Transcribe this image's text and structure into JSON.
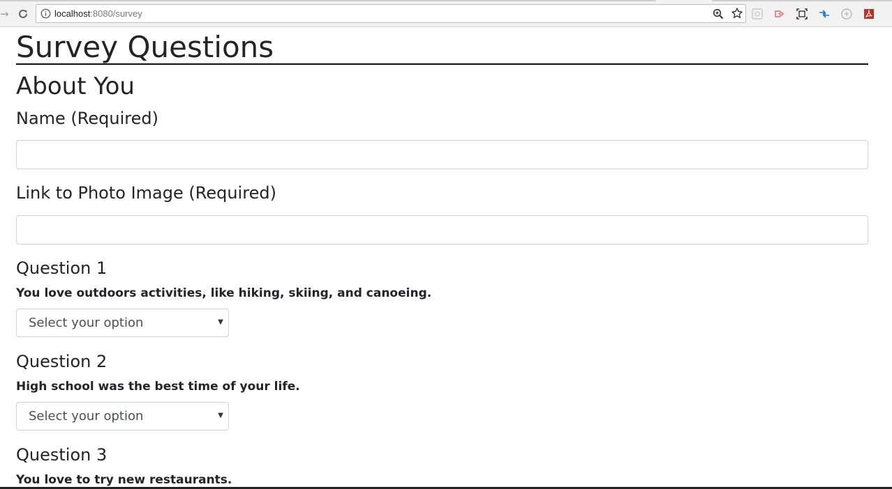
{
  "browser": {
    "url_host": "localhost",
    "url_rest": ":8080/survey"
  },
  "page": {
    "title": "Survey Questions",
    "section_title": "About You"
  },
  "form": {
    "name_label": "Name (Required)",
    "name_value": "",
    "photo_label": "Link to Photo Image (Required)",
    "photo_value": ""
  },
  "questions": [
    {
      "label": "Question 1",
      "text": "You love outdoors activities, like hiking, skiing, and canoeing.",
      "selected": "Select your option"
    },
    {
      "label": "Question 2",
      "text": "High school was the best time of your life.",
      "selected": "Select your option"
    },
    {
      "label": "Question 3",
      "text": "You love to try new restaurants."
    }
  ],
  "colors": {
    "text": "#212529",
    "input_border": "#ced4da"
  }
}
